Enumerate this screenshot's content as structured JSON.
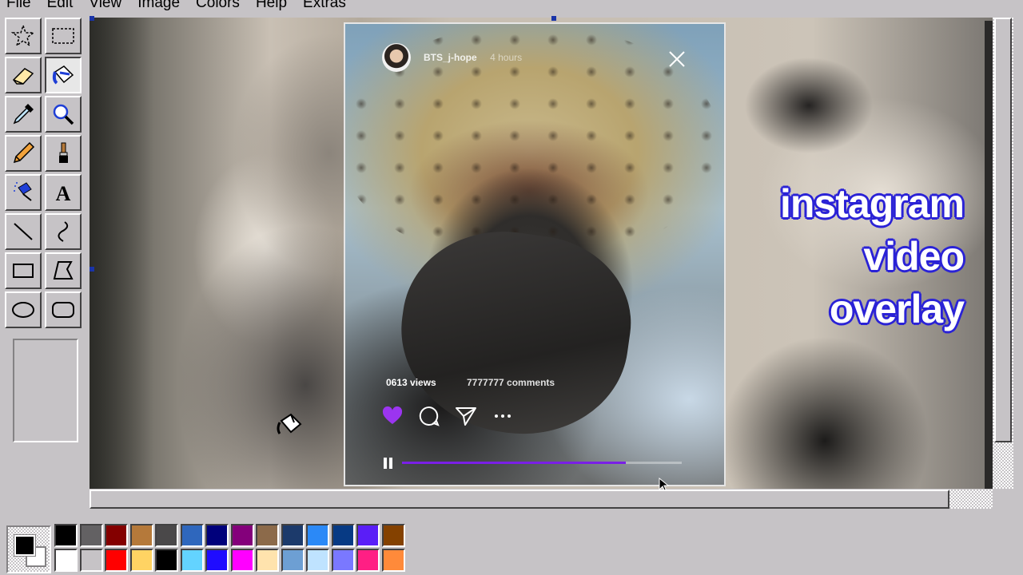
{
  "menubar": {
    "items": [
      "File",
      "Edit",
      "View",
      "Image",
      "Colors",
      "Help",
      "Extras"
    ]
  },
  "toolbox": {
    "tools": [
      {
        "name": "free-form-select",
        "icon": "star-select-icon"
      },
      {
        "name": "rect-select",
        "icon": "rect-select-icon"
      },
      {
        "name": "eraser",
        "icon": "eraser-icon"
      },
      {
        "name": "fill",
        "icon": "paint-bucket-icon",
        "active": true
      },
      {
        "name": "pick-color",
        "icon": "eyedropper-icon"
      },
      {
        "name": "magnifier",
        "icon": "magnifier-icon"
      },
      {
        "name": "pencil",
        "icon": "pencil-icon"
      },
      {
        "name": "brush",
        "icon": "brush-icon"
      },
      {
        "name": "airbrush",
        "icon": "airbrush-icon"
      },
      {
        "name": "text",
        "icon": "text-icon"
      },
      {
        "name": "line",
        "icon": "line-icon"
      },
      {
        "name": "curve",
        "icon": "curve-icon"
      },
      {
        "name": "rectangle",
        "icon": "rectangle-icon"
      },
      {
        "name": "polygon",
        "icon": "polygon-icon"
      },
      {
        "name": "ellipse",
        "icon": "ellipse-icon"
      },
      {
        "name": "rounded-rectangle",
        "icon": "rounded-rectangle-icon"
      }
    ],
    "text_glyph": "A"
  },
  "story": {
    "username": "BTS_j-hope",
    "time": "4 hours",
    "views": "0613 views",
    "comments": "7777777 comments",
    "progress": 0.8,
    "accent": "#7a1fe6",
    "heart_color": "#9b35f0"
  },
  "caption": {
    "lines": [
      "instagram",
      "video",
      "overlay"
    ],
    "fill": "#ffffff",
    "outline": "#2a22d6"
  },
  "palette": {
    "foreground": "#000000",
    "background": "#ffffff",
    "top_row": [
      "#000000",
      "#636163",
      "#840000",
      "#b5793a",
      "#4a4849",
      "#2f67bd",
      "#00007b",
      "#84007b",
      "#8c6a4a",
      "#1c3a6b",
      "#2b89f7",
      "#073a84",
      "#5a1ef7",
      "#844100"
    ],
    "bottom_row": [
      "#ffffff",
      "#c6c3c6",
      "#ff0000",
      "#ffd363",
      "#000000",
      "#63d3ff",
      "#1f0cff",
      "#ff00ff",
      "#ffe3ad",
      "#6d9fd3",
      "#bfe3ff",
      "#7a78ff",
      "#ff1f84",
      "#ff8a3a"
    ]
  }
}
